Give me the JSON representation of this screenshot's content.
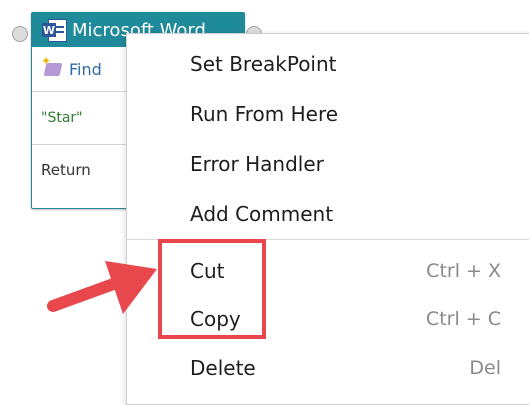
{
  "node": {
    "title": "Microsoft Word",
    "action": "Find",
    "value": "\"Star\"",
    "output": "Return"
  },
  "context_menu": {
    "items": [
      {
        "label": "Set BreakPoint",
        "shortcut": ""
      },
      {
        "label": "Run From Here",
        "shortcut": ""
      },
      {
        "label": "Error Handler",
        "shortcut": ""
      },
      {
        "label": "Add Comment",
        "shortcut": ""
      },
      {
        "label": "Cut",
        "shortcut": "Ctrl + X"
      },
      {
        "label": "Copy",
        "shortcut": "Ctrl + C"
      },
      {
        "label": "Delete",
        "shortcut": "Del"
      }
    ]
  },
  "annotation": {
    "color": "#e8474b",
    "target": "Cut and Copy menu items"
  },
  "colors": {
    "node_header": "#1f8a9a",
    "find_text": "#2f6ea5",
    "value_text": "#2e7d32"
  }
}
